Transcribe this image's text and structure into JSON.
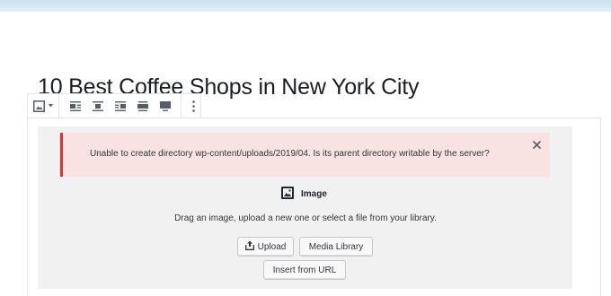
{
  "post": {
    "title": "10 Best Coffee Shops in New York City"
  },
  "toolbar": {
    "items": [
      {
        "icon": "image-block-icon",
        "has_dropdown": true
      },
      {
        "icon": "align-left-icon"
      },
      {
        "icon": "align-center-icon"
      },
      {
        "icon": "align-right-icon"
      },
      {
        "icon": "wide-width-icon"
      },
      {
        "icon": "full-width-icon"
      },
      {
        "icon": "more-options-icon"
      }
    ]
  },
  "notice": {
    "message": "Unable to create directory wp-content/uploads/2019/04. Is its parent directory writable by the server?",
    "dismiss_icon": "close-icon",
    "accent_color": "#dc3232",
    "background_color": "#f9e2e2"
  },
  "image_block": {
    "label": "Image",
    "instructions": "Drag an image, upload a new one or select a file from your library.",
    "upload_label": "Upload",
    "media_library_label": "Media Library",
    "insert_url_label": "Insert from URL"
  }
}
